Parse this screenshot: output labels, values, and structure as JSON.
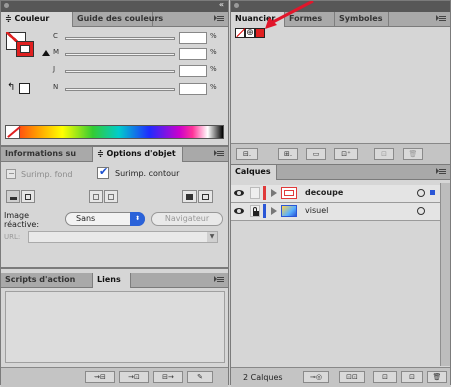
{
  "colors": {
    "titlebar": "#575757",
    "panel_bg": "#d6d6d6",
    "tab_bg": "#a9a9a9",
    "layer_red": "#e03a3a",
    "layer_blue": "#2a56d6",
    "arrow_red": "#e1162b"
  },
  "color_panel": {
    "tabs": [
      "≑ Couleur",
      "Guide des couleurs"
    ],
    "channels": [
      {
        "label": "C",
        "unit": "%"
      },
      {
        "label": "M",
        "unit": "%"
      },
      {
        "label": "J",
        "unit": "%"
      },
      {
        "label": "N",
        "unit": "%"
      }
    ]
  },
  "attributes_panel": {
    "tabs": [
      "Informations su",
      "≑ Options d'objet"
    ],
    "overprint_fill": "Surimp. fond",
    "overprint_stroke": "Surimp. contour",
    "image_map_label": "Image réactive:",
    "image_map_value": "Sans",
    "browser_button": "Navigateur",
    "url_label": "URL:"
  },
  "actions_panel": {
    "tabs": [
      "Scripts d'action",
      "Liens"
    ]
  },
  "swatches_panel": {
    "tabs": [
      "Nuancier",
      "Formes",
      "Symboles"
    ]
  },
  "layers_panel": {
    "tab": "Calques",
    "layers": [
      {
        "name": "decoupe",
        "color": "#e03a3a"
      },
      {
        "name": "visuel",
        "color": "#2a56d6"
      }
    ],
    "count_label": "2 Calques"
  }
}
